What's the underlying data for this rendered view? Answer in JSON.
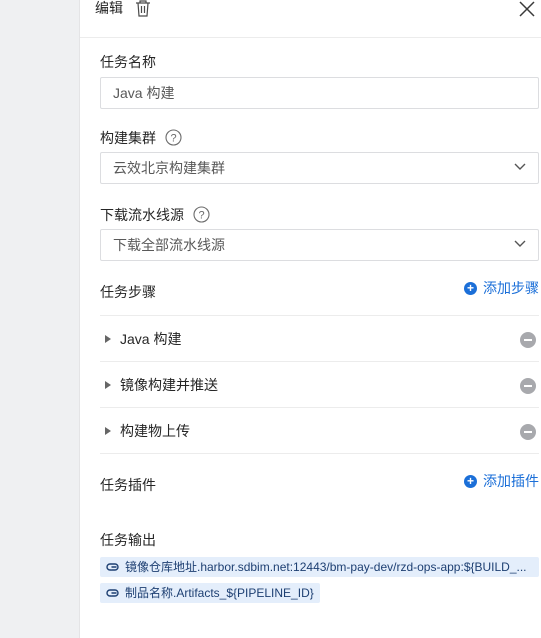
{
  "header": {
    "title": "编辑"
  },
  "task_name": {
    "label": "任务名称",
    "value": "Java 构建"
  },
  "build_cluster": {
    "label": "构建集群",
    "value": "云效北京构建集群"
  },
  "download_source": {
    "label": "下载流水线源",
    "value": "下载全部流水线源"
  },
  "steps": {
    "label": "任务步骤",
    "add_label": "添加步骤",
    "items": [
      {
        "label": "Java 构建"
      },
      {
        "label": "镜像构建并推送"
      },
      {
        "label": "构建物上传"
      }
    ]
  },
  "plugins": {
    "label": "任务插件",
    "add_label": "添加插件"
  },
  "outputs": {
    "label": "任务输出",
    "items": [
      {
        "text": "镜像仓库地址.harbor.sdbim.net:12443/bm-pay-dev/rzd-ops-app:${BUILD_..."
      },
      {
        "text": "制品名称.Artifacts_${PIPELINE_ID}"
      }
    ]
  },
  "colors": {
    "accent": "#1b6fd8",
    "tag_bg": "#e4eefb",
    "remove": "#a8a9ad"
  }
}
